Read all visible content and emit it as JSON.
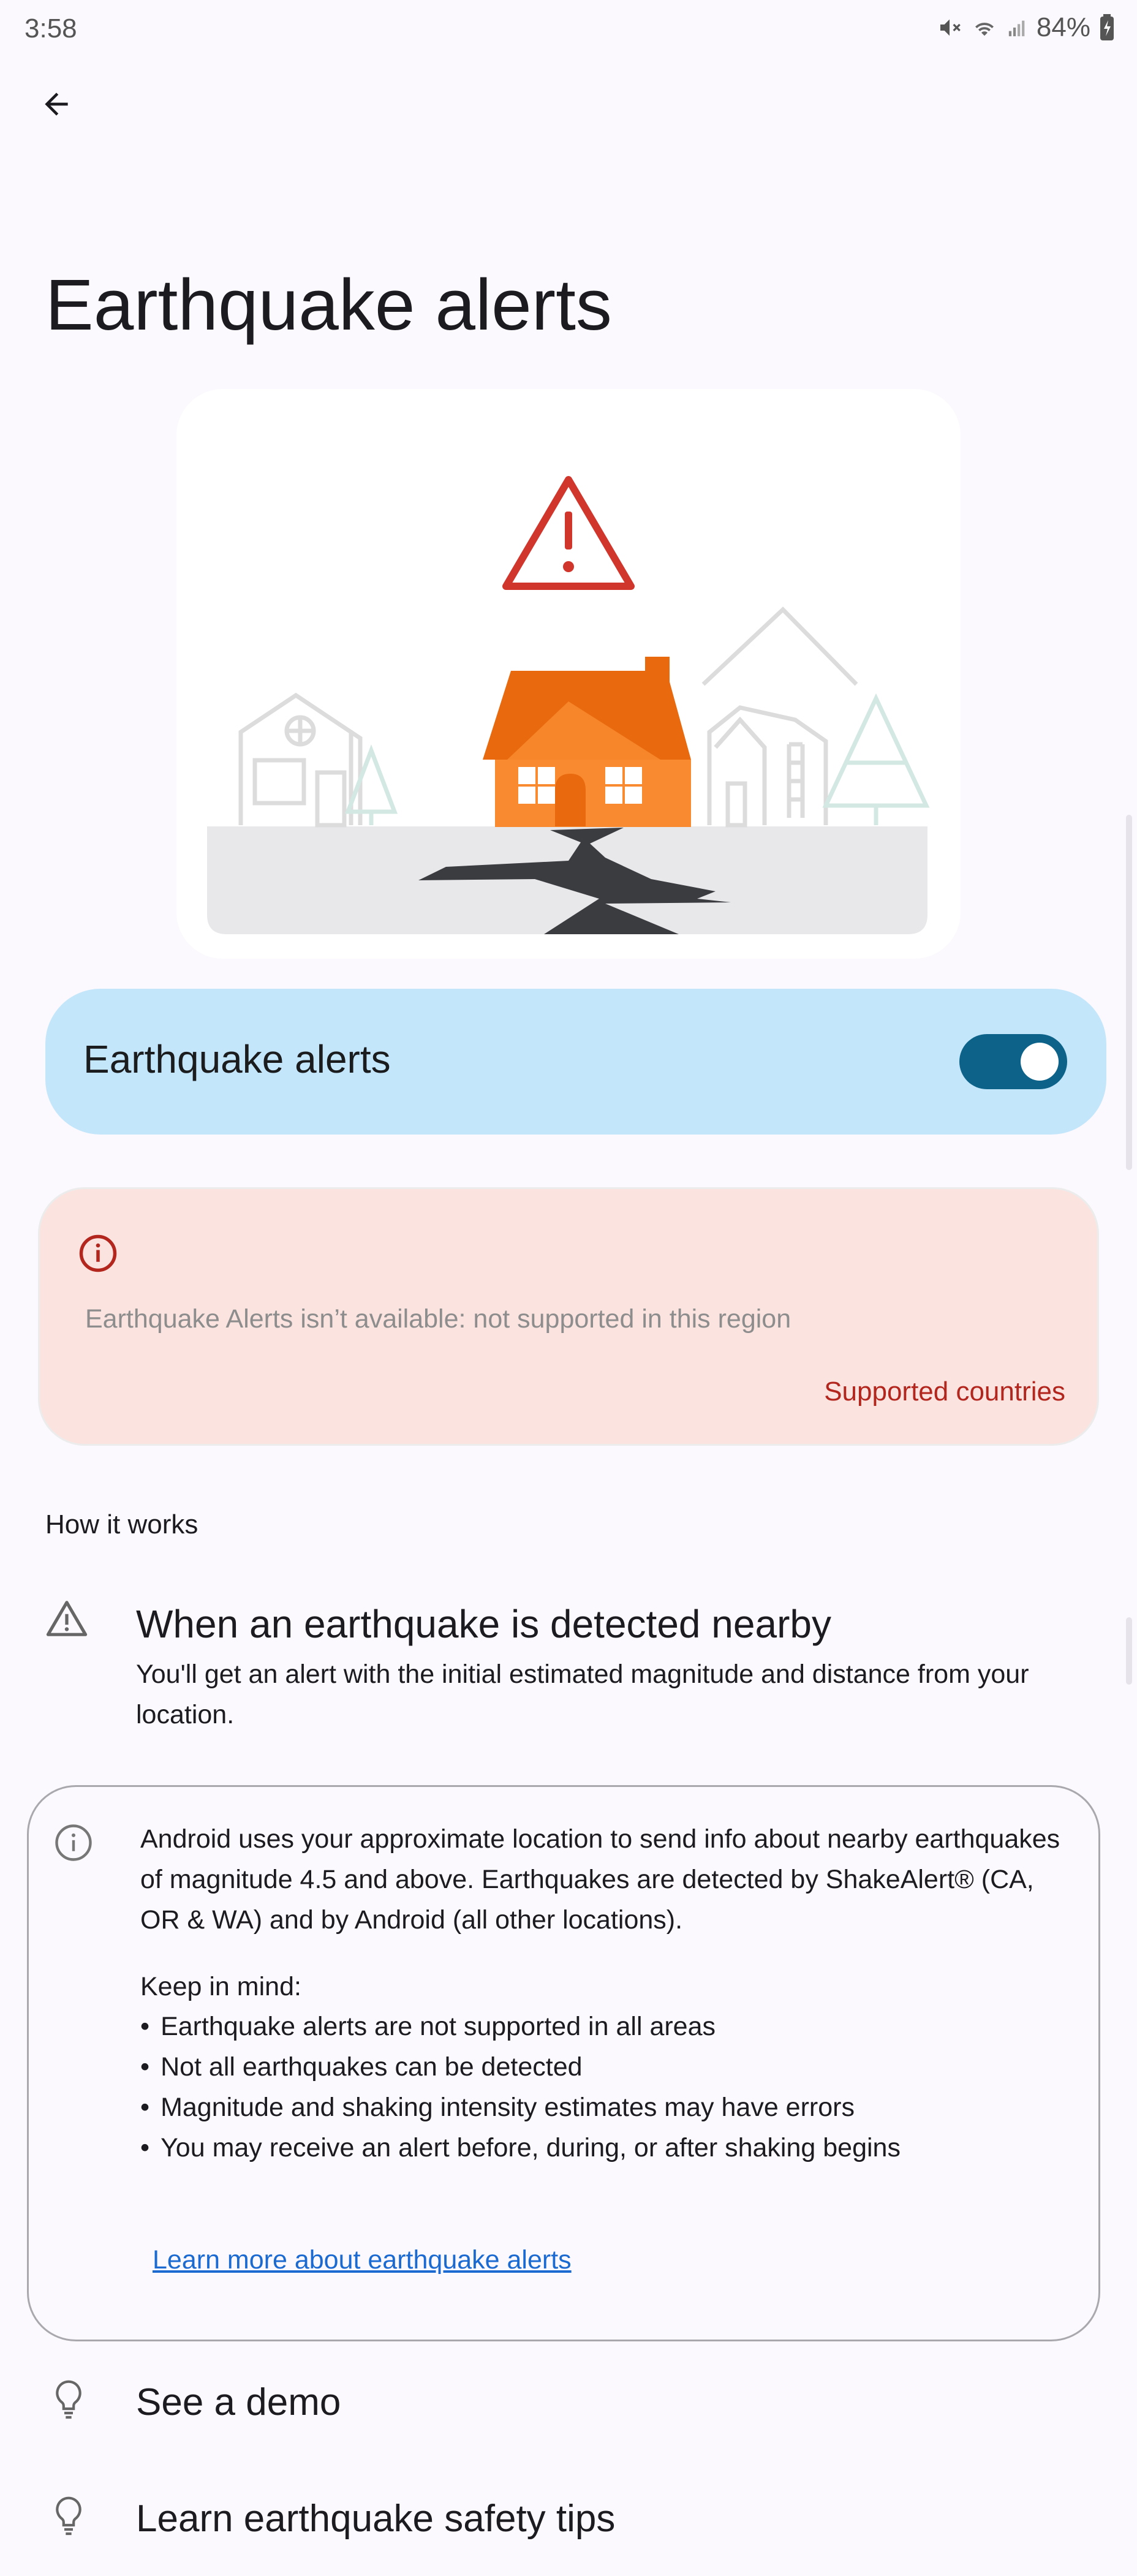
{
  "status_bar": {
    "time": "3:58",
    "battery": "84%",
    "icons": [
      "mute-icon",
      "wifi-icon",
      "signal-icon",
      "battery-icon"
    ]
  },
  "header": {
    "back_icon": "arrow-back-icon",
    "title": "Earthquake alerts"
  },
  "hero": {
    "illustration": "earthquake-house-illustration",
    "colors": {
      "warning_red": "#d1362d",
      "house_orange": "#f98a2f",
      "roof_orange": "#e96a0e",
      "crack": "#3b3c40",
      "ground": "#e8e8eb"
    }
  },
  "toggle_card": {
    "label": "Earthquake alerts",
    "enabled": true,
    "color": "#c3e6fb",
    "switch_color": "#0c6288"
  },
  "error_card": {
    "icon": "error-info-icon",
    "message": "Earthquake Alerts isn’t available: not supported in this region",
    "link": "Supported countries",
    "color": "#fbe3df"
  },
  "how_it_works": {
    "header": "How it works",
    "item": {
      "icon": "warning-triangle-icon",
      "title": "When an earthquake is detected nearby",
      "body": "You'll get an alert with the initial estimated magnitude and distance from your location."
    }
  },
  "info_card": {
    "icon": "info-icon",
    "paragraph": "Android uses your approximate location to send info about nearby earthquakes of magnitude 4.5 and above. Earthquakes are detected by ShakeAlert® (CA, OR & WA) and by Android (all other locations).",
    "keep_in_mind_title": "Keep in mind:",
    "keep_in_mind": [
      "Earthquake alerts are not supported in all areas",
      "Not all earthquakes can be detected",
      "Magnitude and shaking intensity estimates may have errors",
      "You may receive an alert before, during, or after shaking begins"
    ],
    "link": "Learn more about earthquake alerts"
  },
  "rows": [
    {
      "icon": "lightbulb-icon",
      "label": "See a demo"
    },
    {
      "icon": "lightbulb-icon",
      "label": "Learn earthquake safety tips"
    }
  ]
}
